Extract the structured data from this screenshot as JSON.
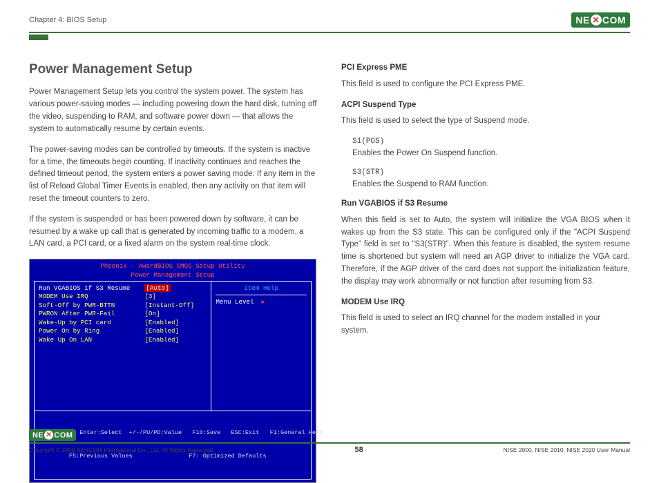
{
  "header": {
    "chapter": "Chapter 4: BIOS Setup"
  },
  "logo": {
    "pre": "NE",
    "x": "✕",
    "post": "COM"
  },
  "left": {
    "title": "Power Management Setup",
    "p1": "Power Management Setup lets you control the system power. The system has various power-saving modes — including powering down the hard disk, turning off the video, suspending to RAM, and software power down — that allows the system to automatically resume by certain events.",
    "p2": "The power-saving modes can be controlled by timeouts. If the system is inactive for a time, the timeouts begin counting. If inactivity continues and reaches the defined timeout period, the system enters a power saving mode. If any item in the list of Reload Global Timer Events is enabled, then any activity on that item will reset the timeout counters to zero.",
    "p3": "If the system is suspended or has been powered down by software, it can be resumed by a wake up call that is generated by incoming traffic to a modem, a LAN card, a PCI card, or a fixed alarm on the system real-time clock."
  },
  "bios": {
    "title1": "Phoenix - AwardBIOS CMOS Setup Utility",
    "title2": "Power Management Setup",
    "rows": [
      {
        "label": "Run VGABIOS if S3 Resume",
        "val": "[Auto]",
        "hl": true
      },
      {
        "label": "MODEM Use IRQ",
        "val": "[3]"
      },
      {
        "label": "Soft-Off by PWR-BTTN",
        "val": "[Instant-Off]"
      },
      {
        "label": "PWRON After PWR-Fail",
        "val": "[On]"
      },
      {
        "label": "Wake-Up by PCI card",
        "val": "[Enabled]"
      },
      {
        "label": "Power On by Ring",
        "val": "[Enabled]"
      },
      {
        "label": "Wake Up On LAN",
        "val": "[Enabled]"
      }
    ],
    "help_title": "Item Help",
    "menu_level": "Menu Level",
    "arrow": "▸",
    "foot1": "↑↓→←:Move   Enter:Select  +/-/PU/PD:Value   F10:Save   ESC:Exit   F1:General Help",
    "foot2": "         F5:Previous Values                F7: Optimized Defaults"
  },
  "right": {
    "h1": "PCI Express PME",
    "p1": "This field is used to configure the PCI Express PME.",
    "h2": "ACPI Suspend Type",
    "p2": "This field is used to select the type of Suspend mode.",
    "d1t": "S1(POS)",
    "d1d": "Enables the Power On Suspend function.",
    "d2t": "S3(STR)",
    "d2d": "Enables the Suspend to RAM function.",
    "h3": "Run VGABIOS if S3 Resume",
    "p3": "When this field is set to Auto, the system will initialize the VGA BIOS when it wakes up from the S3 state. This can be configured only if the \"ACPI Suspend Type\" field is set to \"S3(STR)\". When this feature is disabled, the system resume time is shortened but system will need an AGP driver to initialize the VGA card. Therefore, if the AGP driver of the card does not support the initialization feature, the display may work abnormally or not function after resuming from S3.",
    "h4": "MODEM Use IRQ",
    "p4": "This field is used to select an IRQ channel for the modem installed in your system."
  },
  "footer": {
    "copyright": "Copyright © 2009 NEXCOM International Co., Ltd. All Rights Reserved.",
    "page": "58",
    "manual": "NISE 2000, NISE 2010, NISE 2020 User Manual"
  }
}
